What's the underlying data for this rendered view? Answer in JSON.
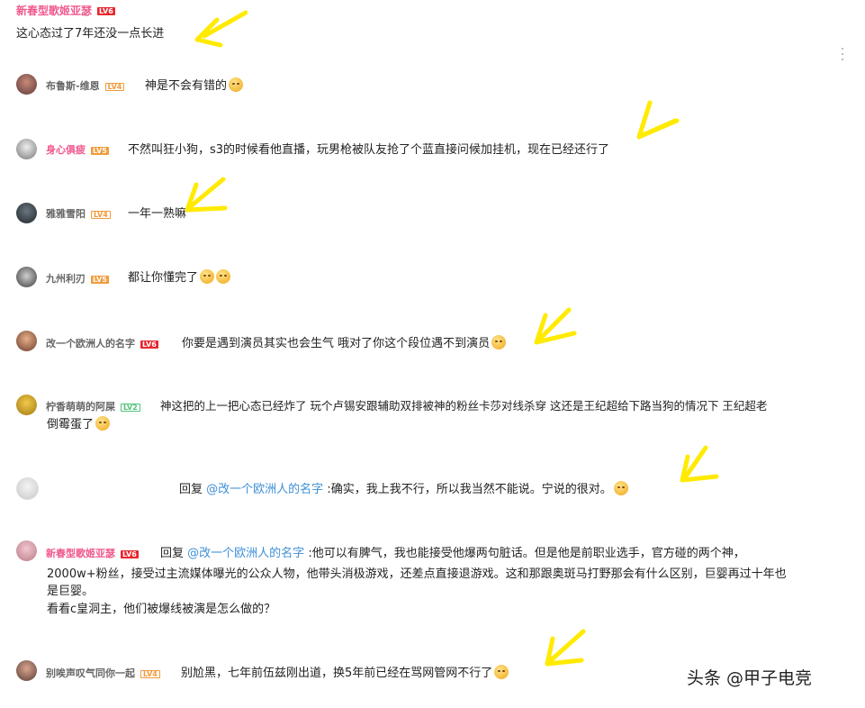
{
  "header": {
    "user": "新春型歌姬亚瑟",
    "level": "LV6",
    "comment": "这心态过了7年还没一点长进"
  },
  "replies": [
    {
      "user": "布鲁斯-维恩",
      "level": "LV4",
      "text": "神是不会有错的"
    },
    {
      "user": "身心俱疲",
      "level": "LV5",
      "text": "不然叫狂小狗，s3的时候看他直播，玩男枪被队友抢了个蓝直接问候加挂机，现在已经还行了"
    },
    {
      "user": "雅雅雪阳",
      "level": "LV4",
      "text": "一年一熟嘛"
    },
    {
      "user": "九州利刃",
      "level": "LV5",
      "text": "都让你懂完了"
    },
    {
      "user": "改一个欧洲人的名字",
      "level": "LV6",
      "text": "你要是遇到演员其实也会生气 哦对了你这个段位遇不到演员"
    },
    {
      "user": "柠香萌萌的阿屎",
      "level": "LV2",
      "text_line1": "神这把的上一把心态已经炸了 玩个卢锡安跟辅助双排被神的粉丝卡莎对线杀穿 这还是王纪超给下路当狗的情况下 王纪超老",
      "text_line2": "倒霉蛋了"
    },
    {
      "user": "",
      "level": "",
      "reply_prefix": "回复",
      "mention": "@改一个欧洲人的名字",
      "text": ":确实，我上我不行，所以我当然不能说。宁说的很对。"
    },
    {
      "user": "新春型歌姬亚瑟",
      "level": "LV6",
      "reply_prefix": "回复",
      "mention": "@改一个欧洲人的名字",
      "text_line1": ":他可以有脾气，我也能接受他爆两句脏话。但是他是前职业选手，官方碰的两个神，",
      "text_line2": "2000w+粉丝，接受过主流媒体曝光的公众人物，他带头消极游戏，还差点直接退游戏。这和那跟奥斑马打野那会有什么区别，巨婴再过十年也",
      "text_line3": "是巨婴。",
      "text_line4": "看看c皇洞主，他们被爆线被演是怎么做的？"
    },
    {
      "user": "别唉声叹气同你一起",
      "level": "LV4",
      "text": "别尬黑，七年前伍兹刚出道，换5年前已经在骂网管网不行了"
    }
  ],
  "watermark": "头条 @甲子电竞",
  "colors": {
    "pink_name": "#f0578d",
    "mention": "#3d8fd6",
    "arrow": "#ffea00"
  },
  "icons": [
    "more-vertical-icon",
    "emoji-icon",
    "arrow-annotation-icon",
    "avatar"
  ]
}
